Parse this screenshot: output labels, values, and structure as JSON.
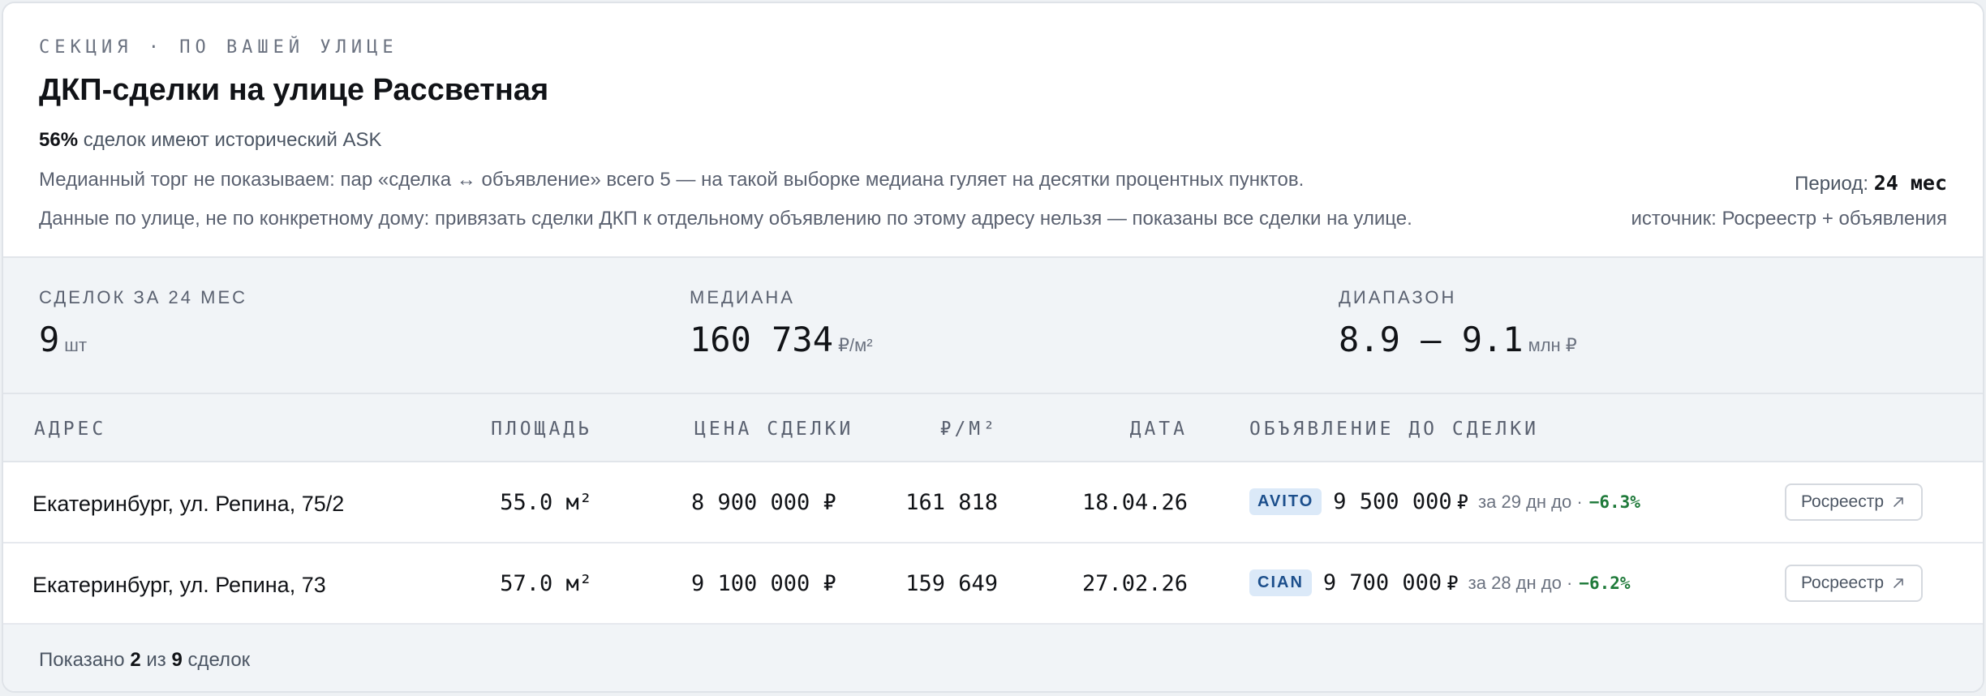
{
  "header": {
    "eyebrow": "СЕКЦИЯ · ПО ВАШЕЙ УЛИЦЕ",
    "title": "ДКП-сделки на улице Рассветная",
    "ask_percent": "56%",
    "ask_text": "сделок имеют исторический ASK",
    "note_median": "Медианный торг не показываем: пар «сделка ↔ объявление» всего 5 — на такой выборке медиана гуляет на десятки процентных пунктов.",
    "note_street": "Данные по улице, не по конкретному дому: привязать сделки ДКП к отдельному объявлению по этому адресу нельзя — показаны все сделки на улице.",
    "period_label": "Период:",
    "period_value": "24 мес",
    "source": "источник: Росреестр + объявления"
  },
  "stats": {
    "deals": {
      "label": "СДЕЛОК ЗА 24 МЕС",
      "value": "9",
      "unit": "шт"
    },
    "median": {
      "label": "МЕДИАНА",
      "value": "160 734",
      "unit": "₽/м²"
    },
    "range": {
      "label": "ДИАПАЗОН",
      "value": "8.9 — 9.1",
      "unit": "млн ₽"
    }
  },
  "table": {
    "headers": {
      "address": "АДРЕС",
      "area": "ПЛОЩАДЬ",
      "price": "ЦЕНА СДЕЛКИ",
      "ppm": "₽/М²",
      "date": "ДАТА",
      "listing": "ОБЪЯВЛЕНИЕ ДО СДЕЛКИ"
    },
    "rows": [
      {
        "address": "Екатеринбург, ул. Репина, 75/2",
        "area": "55.0 м²",
        "price": "8 900 000 ₽",
        "ppm": "161 818",
        "date": "18.04.26",
        "source_badge": "AVITO",
        "listing_price": "9 500 000",
        "listing_currency": "₽",
        "listing_meta": "за 29 дн до ·",
        "listing_diff": "−6.3%",
        "button": "Росреестр"
      },
      {
        "address": "Екатеринбург, ул. Репина, 73",
        "area": "57.0 м²",
        "price": "9 100 000 ₽",
        "ppm": "159 649",
        "date": "27.02.26",
        "source_badge": "CIAN",
        "listing_price": "9 700 000",
        "listing_currency": "₽",
        "listing_meta": "за 28 дн до ·",
        "listing_diff": "−6.2%",
        "button": "Росреестр"
      }
    ]
  },
  "footer": {
    "prefix": "Показано",
    "shown": "2",
    "middle": "из",
    "total": "9",
    "suffix": "сделок"
  },
  "icons": {
    "external_link": "arrow-up-right-icon"
  },
  "colors": {
    "badge_bg": "#dbe9f8",
    "badge_text": "#1c4f8c",
    "diff_green": "#1f7a3a"
  }
}
